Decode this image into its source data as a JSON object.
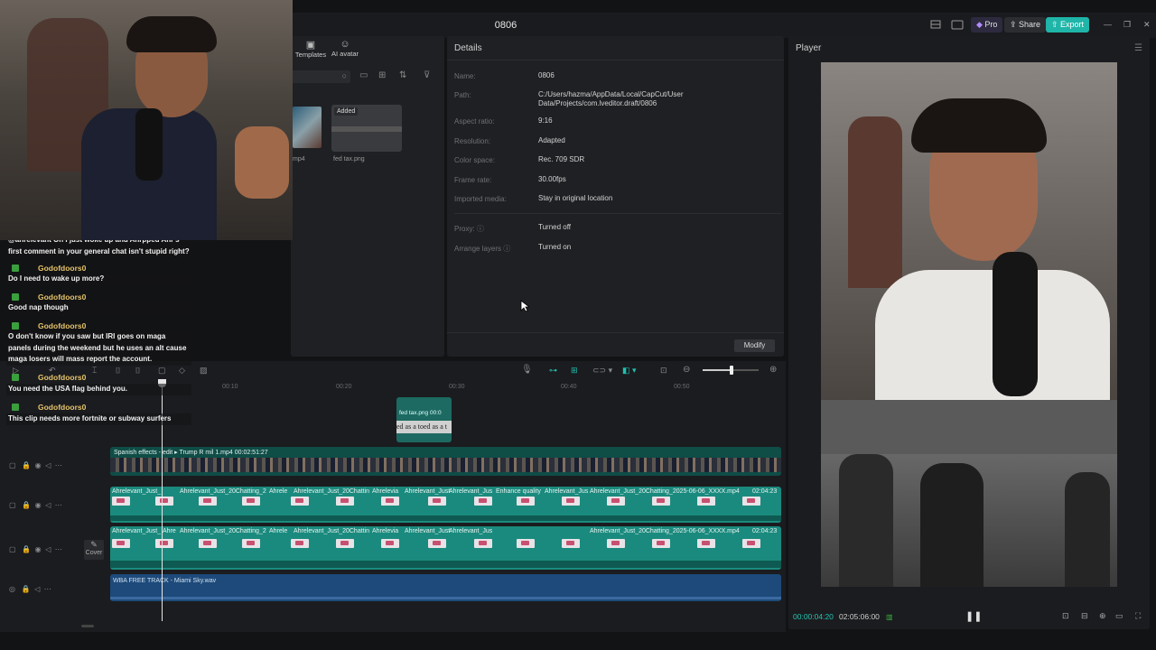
{
  "app": {
    "project_name": "0806"
  },
  "titlebar": {
    "pro_label": "Pro",
    "share_label": "Share",
    "export_label": "Export"
  },
  "media_panel": {
    "tab_templates": "Templates",
    "tab_ai_avatar": "AI avatar",
    "added_badge": "Added",
    "file_left": "mp4",
    "file_name": "fed tax.png"
  },
  "details": {
    "header": "Details",
    "rows": [
      {
        "label": "Name:",
        "value": "0806"
      },
      {
        "label": "Path:",
        "value": "C:/Users/hazma/AppData/Local/CapCut/User Data/Projects/com.lveditor.draft/0806"
      },
      {
        "label": "Aspect ratio:",
        "value": "9:16"
      },
      {
        "label": "Resolution:",
        "value": "Adapted"
      },
      {
        "label": "Color space:",
        "value": "Rec. 709 SDR"
      },
      {
        "label": "Frame rate:",
        "value": "30.00fps"
      },
      {
        "label": "Imported media:",
        "value": "Stay in original location"
      }
    ],
    "proxy_label": "Proxy:",
    "proxy_value": "Turned off",
    "arrange_label": "Arrange layers",
    "arrange_value": "Turned on",
    "modify_label": "Modify"
  },
  "chat": {
    "messages": [
      {
        "user": "",
        "text": "@ahrelevant Oh I just woke up and Ahrpped Ahr's first comment in your general chat isn't stupid right?"
      },
      {
        "user": "Godofdoors0",
        "text": "Do I need to wake up more?"
      },
      {
        "user": "Godofdoors0",
        "text": "Good nap though"
      },
      {
        "user": "Godofdoors0",
        "text": "O don't know if you saw but IRI goes on maga panels during the weekend but he uses an alt cause maga losers will mass report the account."
      },
      {
        "user": "Godofdoors0",
        "text": "You need the USA flag behind you."
      },
      {
        "user": "Godofdoors0",
        "text": "This clip needs more fortnite or subway surfers"
      }
    ]
  },
  "timeline": {
    "ruler": [
      "00:10",
      "00:20",
      "00:30",
      "00:40",
      "00:50"
    ],
    "overlay_clip_label": "fed tax.png  00:0",
    "overlay_clip_text": "ed as a toed as a t",
    "main_clip_label": "Spanish effects - edit ▸  Trump R mil 1.mp4  00:02:51:27",
    "clip_names": [
      "Ahrelevant_Just_",
      "Ahrelevant_Just_20Chatting_2",
      "Ahrele",
      "Ahrelevant_Just_20Chattin",
      "Ahrelevia",
      "Ahrelevant_Just",
      "Ahrelevant_Jus",
      "Enhance quality",
      "Ahrelevant_Jus",
      "Ahrelevant_Just_20Chatting_2025-06-06_XXXX.mp4",
      "02:04:23"
    ],
    "clip_names_b": [
      "Ahrelevant_Just_",
      "Ahre",
      "Ahrelevant_Just_20Chatting_2",
      "Ahrele",
      "Ahrelevant_Just_20Chattin",
      "Ahrelevia",
      "Ahrelevant_Just",
      "Ahrelevant_Jus",
      "Ahrelevant_Just_20Chatting_2025-06-06_XXXX.mp4",
      "02:04:23"
    ],
    "audio_label": "WBA FREE TRACK - Miami Sky.wav",
    "cover_label": "Cover"
  },
  "player": {
    "header": "Player",
    "current_time": "00:00:04:20",
    "total_time": "02:05:06:00"
  }
}
